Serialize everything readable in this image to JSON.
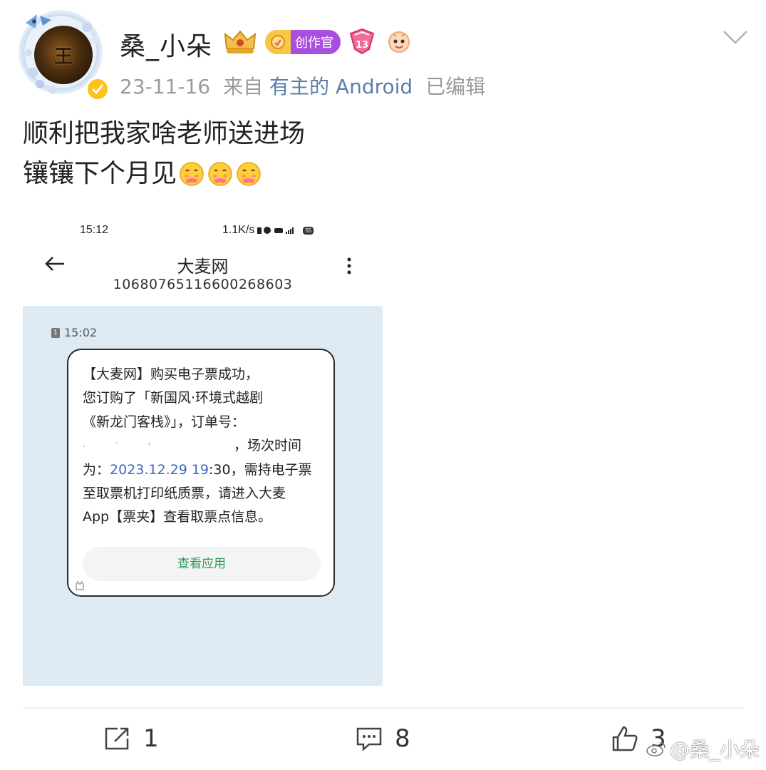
{
  "post": {
    "author": {
      "username": "桑_小朵",
      "avatar_char": "王",
      "badges": {
        "creator_label": "创作官",
        "level_label": "13"
      }
    },
    "meta": {
      "date": "23-11-16",
      "from_label": "来自",
      "source": "有主的 Android",
      "edited_label": "已编辑"
    },
    "text_lines": [
      "顺利把我家啥老师送进场",
      "镶镶下个月见"
    ],
    "emoji_icons": [
      "hug-emoji",
      "hug-emoji",
      "hug-emoji"
    ]
  },
  "screenshot": {
    "status": {
      "time": "15:12",
      "speed": "1.1K/s",
      "battery": "55"
    },
    "sender_name": "大麦网",
    "sender_number": "10680765116600268603",
    "message_time": "15:02",
    "sim_slot": "1",
    "message_lines": [
      "【大麦网】购买电子票成功，",
      "您订购了「新国风·环境式越剧",
      "《新龙门客栈》」，订单号：",
      "，场次时间",
      "为：",
      "2023.12.29 19",
      ":30，需持电子票",
      "至取票机打印纸质票，请进入大麦",
      "App【票夹】查看取票点信息。"
    ],
    "view_app_label": "查看应用"
  },
  "actions": {
    "repost_count": "1",
    "comment_count": "8",
    "like_count": "3"
  },
  "watermark": "@桑_小朵",
  "colors": {
    "verified": "#ffc21a",
    "creator_badge": "#a94fe0",
    "source_link": "#5b7ea8",
    "chat_background": "#dde9f3",
    "view_app_text": "#2e9a5b",
    "date_link": "#3e68c0"
  }
}
